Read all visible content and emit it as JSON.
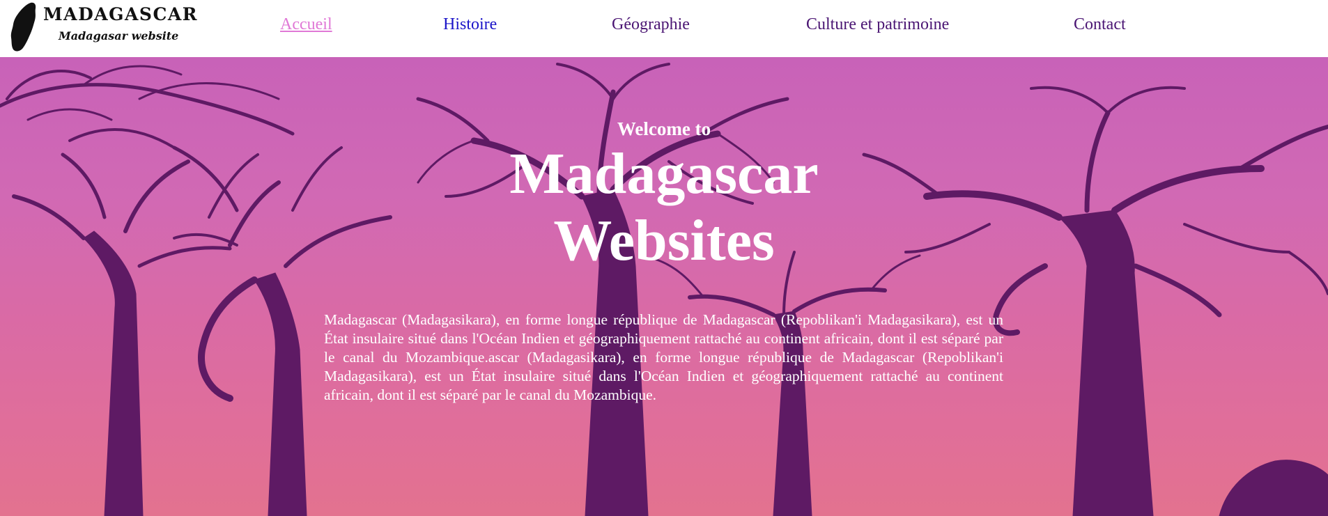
{
  "header": {
    "logo": {
      "title": "MADAGASCAR",
      "subtitle": "Madagasar website",
      "icon": "madagascar-map-icon"
    },
    "nav": [
      {
        "label": "Accueil",
        "state": "current"
      },
      {
        "label": "Histoire",
        "state": "visited-blue"
      },
      {
        "label": "Géographie",
        "state": "visited"
      },
      {
        "label": "Culture et patrimoine",
        "state": "visited"
      },
      {
        "label": "Contact",
        "state": "visited"
      }
    ]
  },
  "hero": {
    "welcome": "Welcome to",
    "title_line1": "Madagascar",
    "title_line2": "Websites",
    "description": "Madagascar (Madagasikara), en forme longue république de Madagascar (Repoblikan'i Madagasikara), est un État insulaire situé dans l'Océan Indien et géographiquement rattaché au continent africain, dont il est séparé par le canal du Mozambique.ascar (Madagasikara), en forme longue république de Madagascar (Repoblikan'i Madagasikara), est un État insulaire situé dans l'Océan Indien et géographiquement rattaché au continent africain, dont il est séparé par le canal du Mozambique.",
    "background": "baobab-trees-at-sunset"
  },
  "colors": {
    "nav_current": "#e078d6",
    "nav_blue": "#1b14c8",
    "nav_default": "#4a1573",
    "hero_top": "#c862b8",
    "hero_bottom": "#e3728f",
    "tree_silhouette": "#5e1a64"
  }
}
